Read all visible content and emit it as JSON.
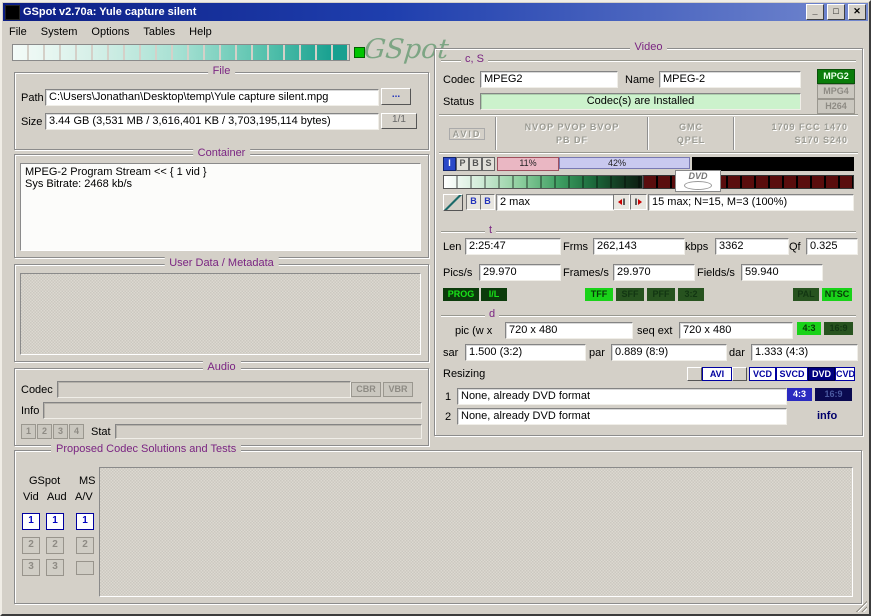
{
  "window": {
    "title": "GSpot v2.70a: Yule capture silent",
    "minimize": "_",
    "maximize": "□",
    "close": "✕"
  },
  "menu": {
    "items": [
      "File",
      "System",
      "Options",
      "Tables",
      "Help"
    ]
  },
  "logo_text": "GSpot",
  "file": {
    "title": "File",
    "path_label": "Path",
    "path_value": "C:\\Users\\Jonathan\\Desktop\\temp\\Yule capture silent.mpg",
    "browse_label": "...",
    "size_label": "Size",
    "size_value": "3.44 GB (3,531 MB / 3,616,401 KB / 3,703,195,114 bytes)",
    "nav_label": "1/1"
  },
  "container": {
    "title": "Container",
    "line1": "MPEG-2 Program Stream << { 1 vid }",
    "line2": "Sys Bitrate: 2468 kb/s"
  },
  "userdata": {
    "title": "User Data / Metadata"
  },
  "audio": {
    "title": "Audio",
    "codec_label": "Codec",
    "cbr": "CBR",
    "vbr": "VBR",
    "info_label": "Info",
    "s1": "1",
    "s2": "2",
    "s3": "3",
    "s4": "4",
    "stat_label": "Stat"
  },
  "video": {
    "title": "Video",
    "section_label": "c, S",
    "codec_label": "Codec",
    "codec_value": "MPEG2",
    "name_label": "Name",
    "name_value": "MPEG-2",
    "status_label": "Status",
    "status_value": "Codec(s) are Installed",
    "badge_mpg2": "MPG2",
    "badge_mpg4": "MPG4",
    "badge_h264": "H264",
    "flag_avid": "AVID",
    "flag_row1": "NVOP  PVOP  BVOP",
    "flag_row2": "PB  DF",
    "flag_gmc": "GMC",
    "flag_qpel": "QPEL",
    "flag_fcc1": "1709  FCC  1470",
    "flag_fcc2": "S170  S240",
    "ft_i": "I",
    "ft_p": "P",
    "ft_b": "B",
    "ft_s": "S",
    "pct_i": "11%",
    "pct_p": "42%",
    "b_icon": "B",
    "i_icon": "I",
    "bmax_value": "2 max",
    "gop_value": "15 max; N=15, M=3 (100%)",
    "dvd_text": "DVD",
    "t_label": "t",
    "len_label": "Len",
    "len_value": "2:25:47",
    "frms_label": "Frms",
    "frms_value": "262,143",
    "kbps_label": "kbps",
    "kbps_value": "3362",
    "qf_label": "Qf",
    "qf_value": "0.325",
    "pics_label": "Pics/s",
    "pics_value": "29.970",
    "framesps_label": "Frames/s",
    "framesps_value": "29.970",
    "fieldsps_label": "Fields/s",
    "fieldsps_value": "59.940",
    "ind_prog": "PROG",
    "ind_il": "I/L",
    "ind_tff": "TFF",
    "ind_sff": "SFF",
    "ind_pff": "PFF",
    "ind_32": "3:2",
    "ind_pal": "PAL",
    "ind_ntsc": "NTSC",
    "d_label": "d",
    "pic_label": "pic (w x",
    "pic_value": "720 x 480",
    "seq_label": "seq ext",
    "seq_value": "720 x 480",
    "ar_43": "4:3",
    "ar_169": "16:9",
    "sar_label": "sar",
    "sar_value": "1.500 (3:2)",
    "par_label": "par",
    "par_value": "0.889 (8:9)",
    "dar_label": "dar",
    "dar_value": "1.333 (4:3)",
    "resizing_label": "Resizing",
    "btn_avi": "AVI",
    "btn_vcd": "VCD",
    "btn_svcd": "SVCD",
    "btn_dvd": "DVD",
    "btn_cvd": "CVD",
    "r1_num": "1",
    "r1_value": "None, already DVD format",
    "r1_43": "4:3",
    "r1_169": "16:9",
    "r2_num": "2",
    "r2_value": "None, already DVD format",
    "info_label": "info"
  },
  "solutions": {
    "title": "Proposed Codec Solutions and Tests",
    "gspot_label": "GSpot",
    "ms_label": "MS",
    "vid_label": "Vid",
    "aud_label": "Aud",
    "av_label": "A/V",
    "n1": "1",
    "n2": "2",
    "n3": "3"
  }
}
